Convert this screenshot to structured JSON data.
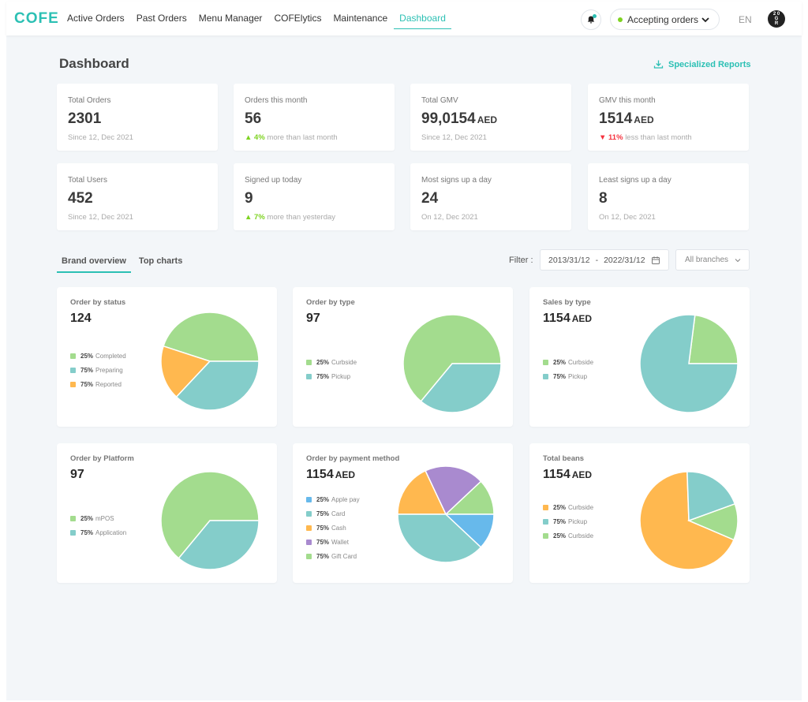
{
  "app": {
    "logo": "COFE",
    "nav": [
      {
        "label": "Active Orders",
        "active": false
      },
      {
        "label": "Past Orders",
        "active": false
      },
      {
        "label": "Menu Manager",
        "active": false
      },
      {
        "label": "COFElytics",
        "active": false
      },
      {
        "label": "Maintenance",
        "active": false
      },
      {
        "label": "Dashboard",
        "active": true
      }
    ],
    "status": {
      "label": "Accepting orders",
      "color": "#7ed321"
    },
    "language": "EN",
    "avatar_text": "2 0 G R",
    "accent_color": "#2cc0b4"
  },
  "page": {
    "title": "Dashboard",
    "reports_link": "Specialized Reports"
  },
  "stats": [
    {
      "label": "Total Orders",
      "value": "2301",
      "unit": "",
      "sub": "Since 12, Dec 2021",
      "trend": null
    },
    {
      "label": "Orders this month",
      "value": "56",
      "unit": "",
      "sub": "more than last month",
      "trend": {
        "dir": "up",
        "pct": "4%"
      }
    },
    {
      "label": "Total GMV",
      "value": "99,0154",
      "unit": "AED",
      "sub": "Since 12, Dec 2021",
      "trend": null
    },
    {
      "label": "GMV this month",
      "value": "1514",
      "unit": "AED",
      "sub": "less than last month",
      "trend": {
        "dir": "down",
        "pct": "11%"
      }
    },
    {
      "label": "Total Users",
      "value": "452",
      "unit": "",
      "sub": "Since 12, Dec 2021",
      "trend": null
    },
    {
      "label": "Signed up today",
      "value": "9",
      "unit": "",
      "sub": "more than yesterday",
      "trend": {
        "dir": "up",
        "pct": "7%"
      }
    },
    {
      "label": "Most signs up a day",
      "value": "24",
      "unit": "",
      "sub": "On 12, Dec 2021",
      "trend": null
    },
    {
      "label": "Least signs up a day",
      "value": "8",
      "unit": "",
      "sub": "On 12, Dec 2021",
      "trend": null
    }
  ],
  "tabs": [
    {
      "label": "Brand overview",
      "active": true
    },
    {
      "label": "Top charts",
      "active": false
    }
  ],
  "filter": {
    "label": "Filter :",
    "date_from": "2013/31/12",
    "date_sep": "-",
    "date_to": "2022/31/12",
    "branch": "All branches"
  },
  "chart_data": [
    {
      "type": "pie",
      "title": "Order by status",
      "total": "124",
      "unit": "",
      "legend": [
        {
          "pct": "25%",
          "label": "Completed",
          "color": "#a3dc8e"
        },
        {
          "pct": "75%",
          "label": "Preparing",
          "color": "#84cdca"
        },
        {
          "pct": "75%",
          "label": "Reported",
          "color": "#ffb84f"
        }
      ],
      "start_angle_deg": 0,
      "slices": [
        {
          "label": "Completed",
          "value": 45,
          "color": "#a3dc8e"
        },
        {
          "label": "Reported",
          "value": 18,
          "color": "#ffb84f"
        },
        {
          "label": "Preparing",
          "value": 37,
          "color": "#84cdca"
        }
      ]
    },
    {
      "type": "pie",
      "title": "Order by type",
      "total": "97",
      "unit": "",
      "legend": [
        {
          "pct": "25%",
          "label": "Curbside",
          "color": "#a3dc8e"
        },
        {
          "pct": "75%",
          "label": "Pickup",
          "color": "#84cdca"
        }
      ],
      "start_angle_deg": 0,
      "slices": [
        {
          "label": "Curbside",
          "value": 64,
          "color": "#a3dc8e"
        },
        {
          "label": "Pickup",
          "value": 36,
          "color": "#84cdca"
        }
      ]
    },
    {
      "type": "pie",
      "title": "Sales by type",
      "total": "1154",
      "unit": "AED",
      "legend": [
        {
          "pct": "25%",
          "label": "Curbside",
          "color": "#a3dc8e"
        },
        {
          "pct": "75%",
          "label": "Pickup",
          "color": "#84cdca"
        }
      ],
      "start_angle_deg": 0,
      "slices": [
        {
          "label": "Curbside",
          "value": 23,
          "color": "#a3dc8e"
        },
        {
          "label": "Pickup",
          "value": 77,
          "color": "#84cdca"
        }
      ]
    },
    {
      "type": "pie",
      "title": "Order by Platform",
      "total": "97",
      "unit": "",
      "legend": [
        {
          "pct": "25%",
          "label": "mPOS",
          "color": "#a3dc8e"
        },
        {
          "pct": "75%",
          "label": "Application",
          "color": "#84cdca"
        }
      ],
      "start_angle_deg": 0,
      "slices": [
        {
          "label": "mPOS",
          "value": 64,
          "color": "#a3dc8e"
        },
        {
          "label": "Application",
          "value": 36,
          "color": "#84cdca"
        }
      ]
    },
    {
      "type": "pie",
      "title": "Order by payment method",
      "total": "1154",
      "unit": "AED",
      "legend": [
        {
          "pct": "25%",
          "label": "Apple pay",
          "color": "#67b9eb"
        },
        {
          "pct": "75%",
          "label": "Card",
          "color": "#84cdca"
        },
        {
          "pct": "75%",
          "label": "Cash",
          "color": "#ffb84f"
        },
        {
          "pct": "75%",
          "label": "Wallet",
          "color": "#a98acf"
        },
        {
          "pct": "75%",
          "label": "Gift Card",
          "color": "#a3dc8e"
        }
      ],
      "start_angle_deg": 0,
      "slices": [
        {
          "label": "Gift Card",
          "value": 12,
          "color": "#a3dc8e"
        },
        {
          "label": "Wallet",
          "value": 20,
          "color": "#a98acf"
        },
        {
          "label": "Cash",
          "value": 18,
          "color": "#ffb84f"
        },
        {
          "label": "Card",
          "value": 38,
          "color": "#84cdca"
        },
        {
          "label": "Apple pay",
          "value": 12,
          "color": "#67b9eb"
        }
      ]
    },
    {
      "type": "pie",
      "title": "Total beans",
      "total": "1154",
      "unit": "AED",
      "legend": [
        {
          "pct": "25%",
          "label": "Curbside",
          "color": "#ffb84f"
        },
        {
          "pct": "75%",
          "label": "Pickup",
          "color": "#84cdca"
        },
        {
          "pct": "25%",
          "label": "Curbside",
          "color": "#a3dc8e"
        }
      ],
      "start_angle_deg": 92,
      "slices": [
        {
          "label": "Curbside",
          "value": 68,
          "color": "#ffb84f"
        },
        {
          "label": "Curbside",
          "value": 12,
          "color": "#a3dc8e"
        },
        {
          "label": "Pickup",
          "value": 20,
          "color": "#84cdca"
        }
      ]
    }
  ]
}
